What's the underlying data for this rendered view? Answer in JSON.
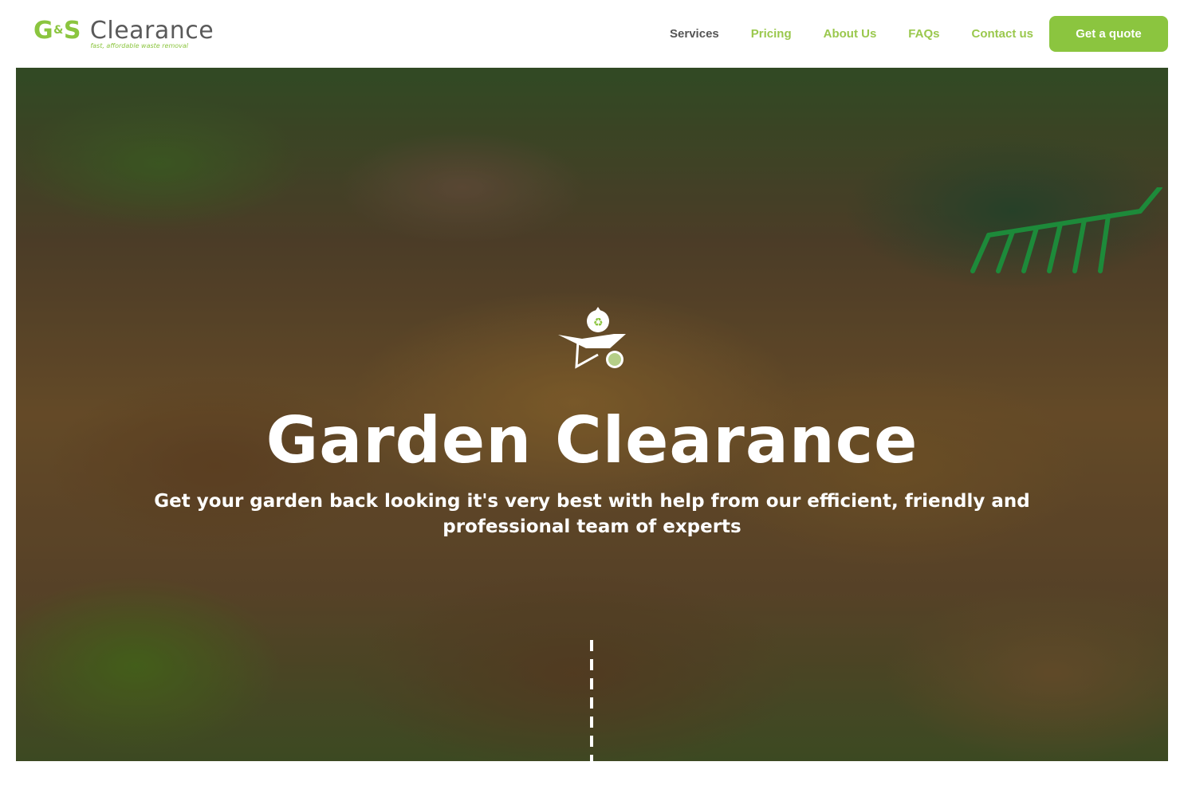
{
  "brand": {
    "logo_gs": "G",
    "logo_amp": "&",
    "logo_s": "S",
    "logo_word": "Clearance",
    "tagline": "fast, affordable waste removal"
  },
  "nav": {
    "items": [
      {
        "label": "Services",
        "active": true
      },
      {
        "label": "Pricing"
      },
      {
        "label": "About Us"
      },
      {
        "label": "FAQs"
      },
      {
        "label": "Contact us"
      }
    ],
    "cta": "Get a quote"
  },
  "hero": {
    "title": "Garden Clearance",
    "subtitle": "Get your garden back looking it's very best with help from our efficient, friendly and professional team of experts",
    "icon": "wheelbarrow-recycle-icon"
  },
  "colors": {
    "accent": "#8bc53f",
    "nav_link": "#9ac84d",
    "nav_active": "#555555",
    "logo_text": "#5a5a5a"
  }
}
